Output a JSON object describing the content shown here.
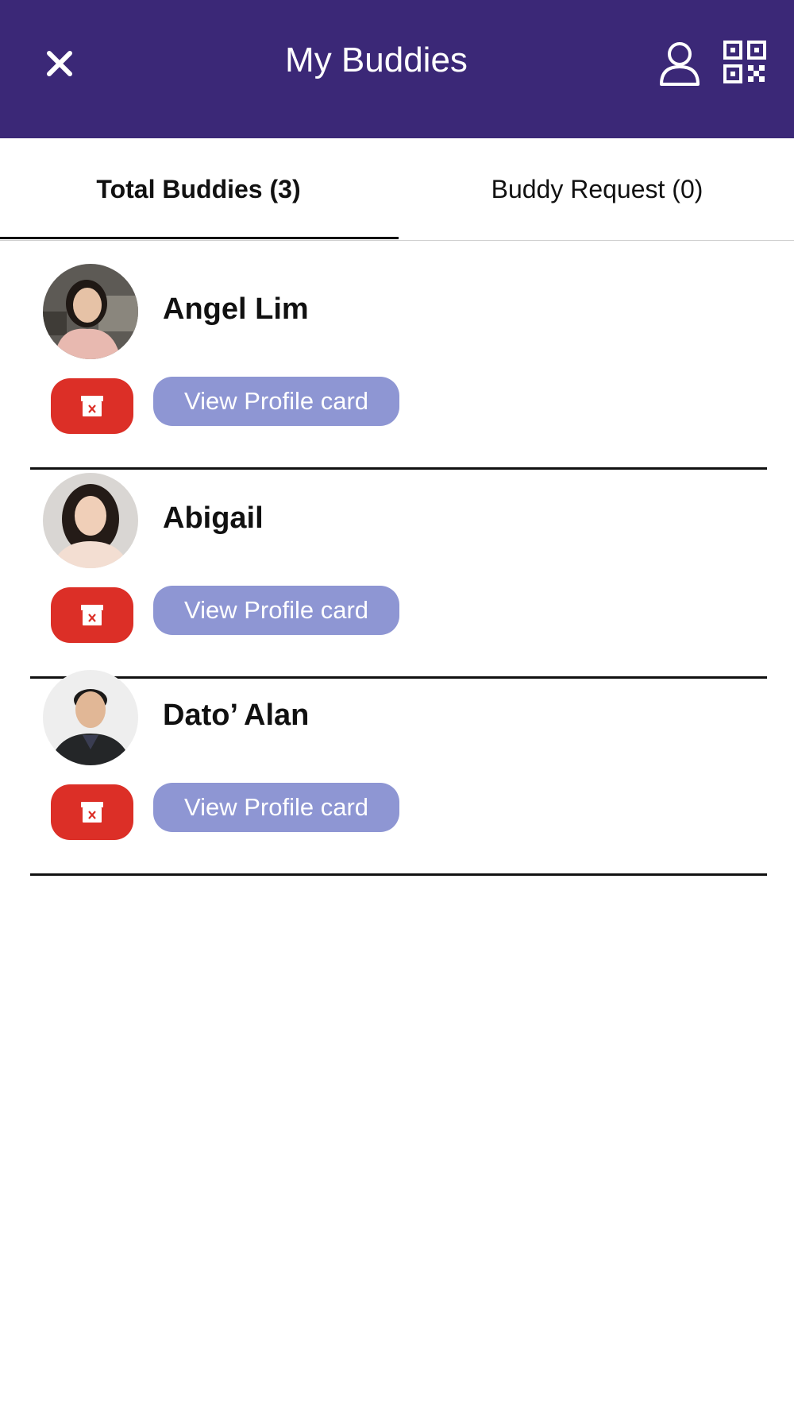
{
  "header": {
    "title": "My Buddies",
    "background_color": "#3b2877",
    "close_icon": "close-icon",
    "profile_icon": "user-icon",
    "qr_icon": "qr-code-icon"
  },
  "tabs": [
    {
      "label": "Total Buddies (3)",
      "active": true
    },
    {
      "label": "Buddy Request (0)",
      "active": false
    }
  ],
  "buddies": [
    {
      "name": "Angel Lim",
      "action_label": "View Profile card"
    },
    {
      "name": "Abigail",
      "action_label": "View Profile card"
    },
    {
      "name": "Dato’ Alan",
      "action_label": "View Profile card"
    }
  ],
  "colors": {
    "delete_button": "#dc2f27",
    "view_button": "#8e96d3"
  }
}
